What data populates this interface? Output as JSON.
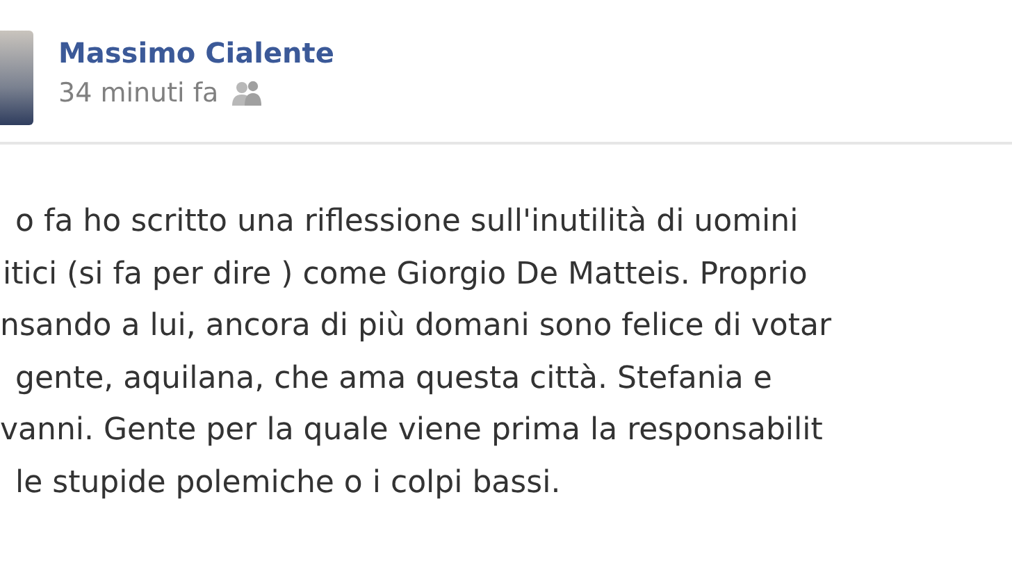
{
  "post": {
    "author": "Massimo Cialente",
    "time": "34 minuti fa",
    "lines": [
      "o fa ho scritto una riflessione sull'inutilità di uomini",
      "itici (si fa per dire ) come Giorgio De Matteis. Proprio",
      "nsando a lui, ancora di più domani sono felice di votar",
      "gente, aquilana, che ama questa città. Stefania e",
      "vanni. Gente per la quale viene prima la responsabilit",
      "le stupide polemiche o i colpi bassi."
    ]
  }
}
